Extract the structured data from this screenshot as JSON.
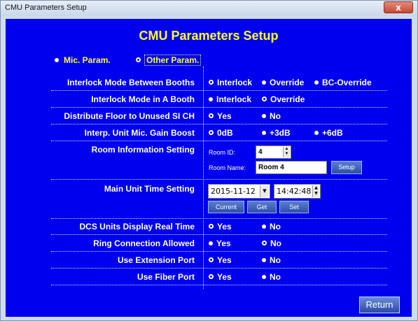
{
  "window": {
    "title": "CMU Parameters Setup",
    "close_glyph": "x"
  },
  "heading": "CMU Parameters Setup",
  "tabs": [
    {
      "label": "Mic. Param.",
      "selected": false
    },
    {
      "label": "Other Param.",
      "selected": true
    }
  ],
  "rows": {
    "interlock_between": {
      "label": "Interlock Mode Between Booths",
      "options": [
        "Interlock",
        "Override",
        "BC-Override"
      ],
      "selected": "Interlock"
    },
    "interlock_in": {
      "label": "Interlock Mode in A Booth",
      "options": [
        "Interlock",
        "Override"
      ],
      "selected": "Override"
    },
    "distribute": {
      "label": "Distribute Floor to Unused SI CH",
      "options": [
        "Yes",
        "No"
      ],
      "selected": "Yes"
    },
    "gain": {
      "label": "Interp. Unit Mic. Gain Boost",
      "options": [
        "0dB",
        "+3dB",
        "+6dB"
      ],
      "selected": "0dB"
    },
    "room": {
      "label": "Room Information Setting",
      "id_label": "Room ID:",
      "id_value": "4",
      "name_label": "Room Name:",
      "name_value": "Room 4",
      "setup_label": "Setup"
    },
    "time": {
      "label": "Main Unit Time Setting",
      "date": "2015-11-12",
      "time": "14:42:48",
      "buttons": [
        "Current",
        "Get",
        "Set"
      ]
    },
    "dcs": {
      "label": "DCS Units Display Real Time",
      "options": [
        "Yes",
        "No"
      ],
      "selected": "Yes"
    },
    "ring": {
      "label": "Ring Connection Allowed",
      "options": [
        "Yes",
        "No"
      ],
      "selected": "No"
    },
    "ext": {
      "label": "Use Extension Port",
      "options": [
        "Yes",
        "No"
      ],
      "selected": "Yes"
    },
    "fiber": {
      "label": "Use Fiber Port",
      "options": [
        "Yes",
        "No"
      ],
      "selected": "Yes"
    }
  },
  "return_label": "Return",
  "colors": {
    "background": "#0000ee",
    "heading": "#ffff33",
    "text": "#ffffff"
  }
}
